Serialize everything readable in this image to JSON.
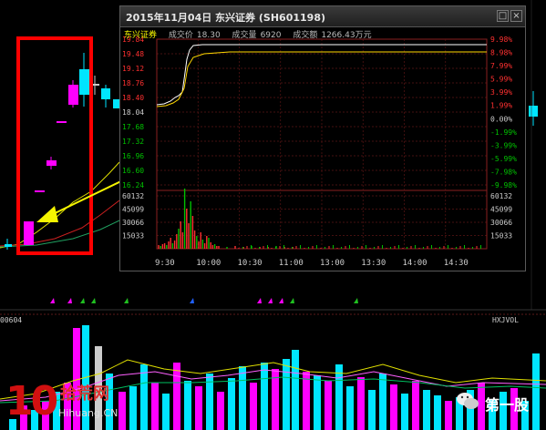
{
  "popup": {
    "title": "2015年11月04日  东兴证券 (SH601198)",
    "stock_name": "东兴证券",
    "price_label": "成交价",
    "price_value": "18.30",
    "volume_label": "成交量",
    "volume_value": "6920",
    "amount_label": "成交额",
    "amount_value": "1266.43万元",
    "left_price_ticks": [
      "19.84",
      "19.48",
      "19.12",
      "18.76",
      "18.40",
      "18.04",
      "17.68",
      "17.32",
      "16.96",
      "16.60",
      "16.24"
    ],
    "right_pct_ticks": [
      "9.98%",
      "8.98%",
      "7.99%",
      "5.99%",
      "3.99%",
      "1.99%",
      "0.00%",
      "-1.99%",
      "-3.99%",
      "-5.99%",
      "-7.98%",
      "-9.98%"
    ],
    "left_vol_ticks": [
      "60132",
      "45099",
      "30066",
      "15033"
    ],
    "right_vol_ticks": [
      "60132",
      "45099",
      "30066",
      "15033"
    ],
    "time_ticks": [
      "9:30",
      "10:00",
      "10:30",
      "11:00",
      "13:00",
      "13:30",
      "14:00",
      "14:30"
    ],
    "close_glyph": "×",
    "restore_glyph": "□",
    "colors": {
      "price_line": "#ffffff",
      "avg_line": "#ffd800",
      "up": "#ff3030",
      "down": "#00c000",
      "grid": "#7a1a1a"
    }
  },
  "main_chart": {
    "left_code": "00604",
    "right_indicator": "HXJVOL",
    "colors": {
      "up_candle": "#ff00ff",
      "down_candle": "#00e5ff",
      "highlight_box": "#ff0000",
      "arrow": "#f0f000"
    }
  },
  "watermark": {
    "number": "10",
    "text": "拾荒网",
    "sub": "Hihuang.CN",
    "right_text": "第一股"
  }
}
